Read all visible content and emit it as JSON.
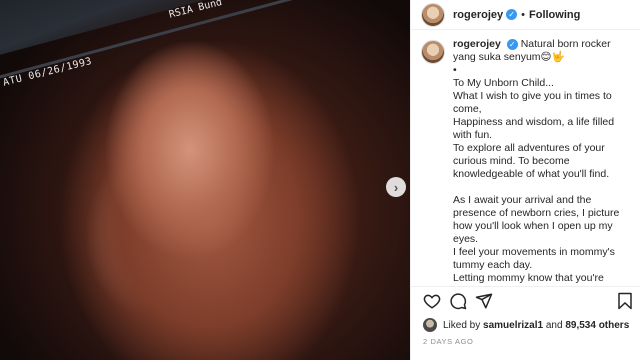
{
  "media": {
    "scan_date": "ATU 06/26/1993",
    "clinic": "RSIA Bund",
    "next_icon": "chevron-right-icon"
  },
  "header": {
    "username": "rogerojey",
    "separator": "•",
    "follow_status": "Following"
  },
  "caption": {
    "username": "rogerojey",
    "first_line": "Natural born rocker yang suka senyum😊🤟",
    "lines": [
      "•",
      "To My Unborn Child...",
      "What I wish to give you in times to come,",
      "Happiness and wisdom, a life filled with fun.",
      "To explore all adventures of your curious mind. To become knowledgeable of what you'll find.",
      "",
      "As I await your arrival and the presence of newborn cries, I picture how you'll look when I open up my eyes.",
      "I feel your movements in mommy's tummy each day.",
      "Letting mommy know that you're"
    ]
  },
  "actions": {
    "like_icon": "heart-icon",
    "comment_icon": "comment-icon",
    "share_icon": "send-icon",
    "save_icon": "bookmark-icon"
  },
  "likes": {
    "prefix": "Liked by",
    "first_liker": "samuelrizal1",
    "conjunction": "and",
    "others": "89,534 others"
  },
  "posted_ago": "2 DAYS AGO",
  "colors": {
    "verified": "#3897f0",
    "meta_text": "#8e8e8e",
    "text": "#262626"
  }
}
